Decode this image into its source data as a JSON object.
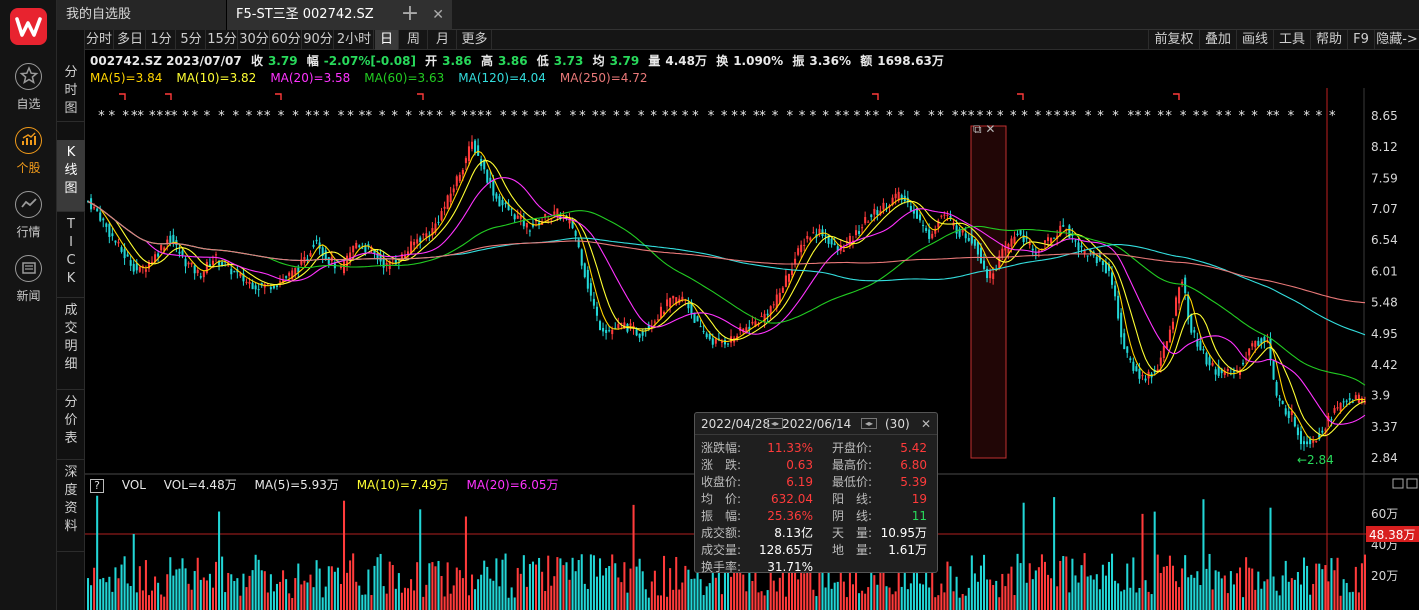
{
  "tabs": {
    "watchlist": "我的自选股",
    "stock": "F5-ST三圣 002742.SZ",
    "add": "+",
    "close": "✕"
  },
  "nav": [
    {
      "label": "自选",
      "icon": "star-icon"
    },
    {
      "label": "个股",
      "icon": "stock-chart-icon"
    },
    {
      "label": "行情",
      "icon": "market-trend-icon"
    },
    {
      "label": "新闻",
      "icon": "news-icon"
    }
  ],
  "periods": [
    "分时",
    "多日",
    "1分",
    "5分",
    "15分",
    "30分",
    "60分",
    "90分",
    "2小时",
    "日",
    "周",
    "月",
    "更多"
  ],
  "active_period": "日",
  "tools": [
    "前复权",
    "叠加",
    "画线",
    "工具",
    "帮助",
    "F9",
    "隐藏->"
  ],
  "vtabs": [
    "分时图",
    "K线图",
    "TICK",
    "成交明细",
    "分价表",
    "深度资料"
  ],
  "info": {
    "code_date": "002742.SZ 2023/07/07",
    "close_label": "收",
    "close": "3.79",
    "range_label": "幅",
    "range": "-2.07%[-0.08]",
    "open_label": "开",
    "open": "3.86",
    "high_label": "高",
    "high": "3.86",
    "low_label": "低",
    "low": "3.73",
    "avg_label": "均",
    "avg": "3.79",
    "vol_label": "量",
    "vol": "4.48万",
    "turnover_label": "换",
    "turnover": "1.090%",
    "amp_label": "振",
    "amp": "3.36%",
    "amount_label": "额",
    "amount": "1698.63万"
  },
  "ma": [
    {
      "text": "MA(5)=3.84",
      "color": "#ffd400"
    },
    {
      "text": "MA(10)=3.82",
      "color": "#ffff33"
    },
    {
      "text": "MA(20)=3.58",
      "color": "#ff33ff"
    },
    {
      "text": "MA(60)=3.63",
      "color": "#22cc22"
    },
    {
      "text": "MA(120)=4.04",
      "color": "#33dddd"
    },
    {
      "text": "MA(250)=4.72",
      "color": "#e87878"
    }
  ],
  "vol_info": {
    "help": "?",
    "name": "VOL",
    "vol": "VOL=4.48万",
    "ma5": "MA(5)=5.93万",
    "ma10": "MA(10)=7.49万",
    "ma20": "MA(20)=6.05万"
  },
  "price_axis": [
    "8.65",
    "8.12",
    "7.59",
    "7.07",
    "6.54",
    "6.01",
    "5.48",
    "4.95",
    "4.42",
    "3.9",
    "3.37",
    "2.84"
  ],
  "vol_axis": [
    "60万",
    "40万",
    "20万"
  ],
  "vol_current": "48.38万",
  "low_marker": "←2.84",
  "popup": {
    "range": "2022/04/28 - 2022/06/14",
    "count": "(30)",
    "rows": [
      {
        "k1": "涨跌幅:",
        "v1": "11.33%",
        "c1": "#ff3b3b",
        "k2": "开盘价:",
        "v2": "5.42",
        "c2": "#ff3b3b"
      },
      {
        "k1": "涨　跌:",
        "v1": "0.63",
        "c1": "#ff3b3b",
        "k2": "最高价:",
        "v2": "6.80",
        "c2": "#ff3b3b"
      },
      {
        "k1": "收盘价:",
        "v1": "6.19",
        "c1": "#ff3b3b",
        "k2": "最低价:",
        "v2": "5.39",
        "c2": "#ff3b3b"
      },
      {
        "k1": "均　价:",
        "v1": "632.04",
        "c1": "#ff3b3b",
        "k2": "阳　线:",
        "v2": "19",
        "c2": "#ff3b3b"
      },
      {
        "k1": "振　幅:",
        "v1": "25.36%",
        "c1": "#ff3b3b",
        "k2": "阴　线:",
        "v2": "11",
        "c2": "#28d95b"
      },
      {
        "k1": "成交额:",
        "v1": "8.13亿",
        "c1": "#ffffff",
        "k2": "天　量:",
        "v2": "10.95万",
        "c2": "#ffffff"
      },
      {
        "k1": "成交量:",
        "v1": "128.65万",
        "c1": "#ffffff",
        "k2": "地　量:",
        "v2": "1.61万",
        "c2": "#ffffff"
      },
      {
        "k1": "换手率:",
        "v1": "31.71%",
        "c1": "#ffffff",
        "k2": "",
        "v2": "",
        "c2": "#ffffff"
      }
    ]
  },
  "chart_data": {
    "type": "candlestick",
    "ylim": [
      2.84,
      8.65
    ],
    "series_colors": {
      "up": "#ff3b3b",
      "down": "#22d6d6"
    },
    "anchors": [
      [
        0,
        7.2
      ],
      [
        10,
        7.0
      ],
      [
        20,
        6.7
      ],
      [
        35,
        6.3
      ],
      [
        50,
        6.0
      ],
      [
        65,
        6.25
      ],
      [
        80,
        6.6
      ],
      [
        95,
        6.2
      ],
      [
        110,
        5.95
      ],
      [
        125,
        6.25
      ],
      [
        140,
        6.05
      ],
      [
        155,
        5.85
      ],
      [
        170,
        5.75
      ],
      [
        185,
        5.8
      ],
      [
        200,
        5.95
      ],
      [
        215,
        6.2
      ],
      [
        225,
        6.6
      ],
      [
        235,
        6.25
      ],
      [
        250,
        6.05
      ],
      [
        265,
        6.5
      ],
      [
        280,
        6.35
      ],
      [
        295,
        6.1
      ],
      [
        310,
        6.25
      ],
      [
        325,
        6.55
      ],
      [
        340,
        6.7
      ],
      [
        355,
        7.2
      ],
      [
        370,
        7.8
      ],
      [
        380,
        8.2
      ],
      [
        392,
        7.7
      ],
      [
        405,
        7.2
      ],
      [
        420,
        7.0
      ],
      [
        435,
        6.75
      ],
      [
        450,
        6.9
      ],
      [
        465,
        7.0
      ],
      [
        480,
        6.75
      ],
      [
        495,
        5.7
      ],
      [
        505,
        5.1
      ],
      [
        515,
        5.0
      ],
      [
        530,
        5.1
      ],
      [
        545,
        4.95
      ],
      [
        560,
        5.2
      ],
      [
        575,
        5.5
      ],
      [
        590,
        5.55
      ],
      [
        605,
        5.0
      ],
      [
        620,
        4.8
      ],
      [
        635,
        4.85
      ],
      [
        650,
        5.05
      ],
      [
        665,
        5.2
      ],
      [
        680,
        5.5
      ],
      [
        695,
        6.1
      ],
      [
        710,
        6.6
      ],
      [
        725,
        6.7
      ],
      [
        740,
        6.35
      ],
      [
        755,
        6.55
      ],
      [
        770,
        6.9
      ],
      [
        785,
        7.1
      ],
      [
        800,
        7.3
      ],
      [
        815,
        7.1
      ],
      [
        830,
        6.6
      ],
      [
        845,
        7.0
      ],
      [
        860,
        6.7
      ],
      [
        875,
        6.55
      ],
      [
        890,
        5.9
      ],
      [
        905,
        6.35
      ],
      [
        920,
        6.7
      ],
      [
        935,
        6.3
      ],
      [
        950,
        6.55
      ],
      [
        965,
        6.8
      ],
      [
        980,
        6.4
      ],
      [
        995,
        6.25
      ],
      [
        1010,
        6.0
      ],
      [
        1025,
        4.6
      ],
      [
        1040,
        4.2
      ],
      [
        1055,
        4.3
      ],
      [
        1070,
        5.0
      ],
      [
        1080,
        6.0
      ],
      [
        1090,
        5.0
      ],
      [
        1105,
        4.5
      ],
      [
        1120,
        4.25
      ],
      [
        1135,
        4.3
      ],
      [
        1150,
        4.75
      ],
      [
        1165,
        4.9
      ],
      [
        1175,
        3.8
      ],
      [
        1190,
        3.55
      ],
      [
        1200,
        3.1
      ],
      [
        1215,
        3.2
      ],
      [
        1230,
        3.6
      ],
      [
        1245,
        3.85
      ],
      [
        1262,
        3.82
      ]
    ]
  }
}
